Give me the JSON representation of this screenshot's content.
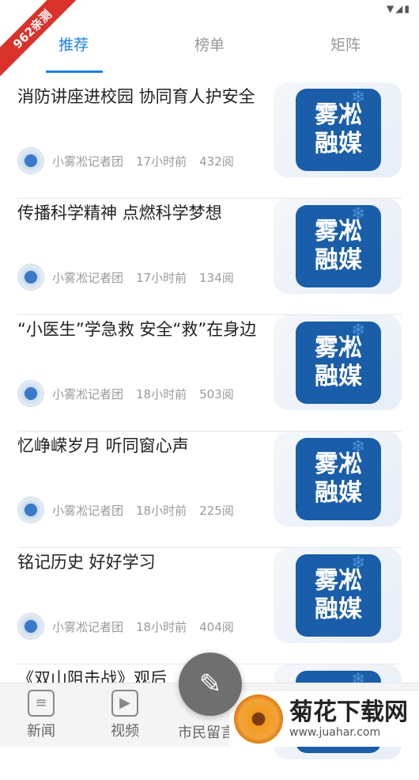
{
  "ribbon_text": "962亲测",
  "status_icons": "▼◢▮",
  "tabs": [
    {
      "label": "推荐"
    },
    {
      "label": "榜单"
    },
    {
      "label": "矩阵"
    }
  ],
  "logo_text": {
    "line1": "雾凇",
    "line2": "融媒"
  },
  "articles": [
    {
      "title": "消防讲座进校园 协同育人护安全",
      "author": "小雾凇记者团",
      "time": "17小时前",
      "reads": "432阅"
    },
    {
      "title": "传播科学精神 点燃科学梦想",
      "author": "小雾凇记者团",
      "time": "17小时前",
      "reads": "134阅"
    },
    {
      "title": "“小医生”学急救 安全“救”在身边",
      "author": "小雾凇记者团",
      "time": "18小时前",
      "reads": "503阅"
    },
    {
      "title": "忆峥嵘岁月 听同窗心声",
      "author": "小雾凇记者团",
      "time": "18小时前",
      "reads": "225阅"
    },
    {
      "title": "铭记历史 好好学习",
      "author": "小雾凇记者团",
      "time": "18小时前",
      "reads": "404阅"
    },
    {
      "title": "《双山阻击战》观后",
      "author": "",
      "time": "",
      "reads": ""
    }
  ],
  "bottom_nav": [
    {
      "label": "新闻",
      "icon": "news-icon"
    },
    {
      "label": "视频",
      "icon": "video-icon"
    },
    {
      "label": "市民留言",
      "icon": "message-icon"
    }
  ],
  "watermark": {
    "title": "菊花下载网",
    "url": "www.juahar.com"
  },
  "colors": {
    "accent": "#1f7fe0",
    "ribbon": "#d8322a",
    "logo_bg": "#1a5da9"
  }
}
